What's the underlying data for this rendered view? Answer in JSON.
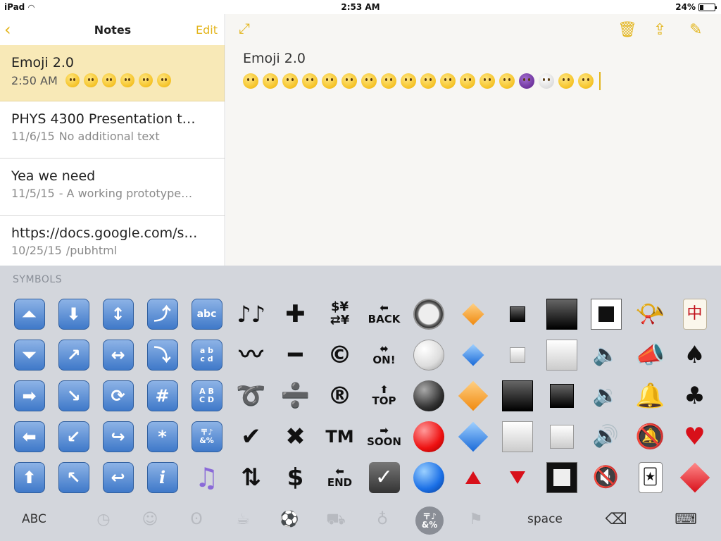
{
  "status_bar": {
    "device": "iPad",
    "time": "2:53 AM",
    "battery": "24%",
    "battery_level": 0.24
  },
  "sidebar": {
    "title": "Notes",
    "edit_label": "Edit",
    "notes": [
      {
        "title": "Emoji 2.0",
        "date": "2:50 AM",
        "preview": "",
        "selected": true
      },
      {
        "title": "PHYS 4300 Presentation t…",
        "date": "11/6/15",
        "preview": "No additional text"
      },
      {
        "title": "Yea we need",
        "date": "11/5/15",
        "preview": "- A working prototype…"
      },
      {
        "title": "https://docs.google.com/s…",
        "date": "10/25/15",
        "preview": "/pubhtml"
      }
    ]
  },
  "editor": {
    "title": "Emoji 2.0"
  },
  "keyboard": {
    "section_label": "SYMBOLS",
    "symbols": [
      [
        "⏫",
        "⬇",
        "↕",
        "⤴",
        "abc",
        "🎶",
        "➕",
        "💱",
        "🔙",
        "🔘",
        "🔸",
        "▪",
        "⬛",
        "🔲",
        "📯",
        "🀄"
      ],
      [
        "⏬",
        "↗",
        "↔",
        "⤵",
        "abcd",
        "〰",
        "➖",
        "©",
        "🔛",
        "⚪",
        "🔹",
        "▫",
        "⬜",
        "🔈",
        "📣",
        "♠"
      ],
      [
        "➡",
        "↘",
        "🔄",
        "#",
        "ABCD",
        "➰",
        "➗",
        "®",
        "🔝",
        "⚫",
        "🔶",
        "◼",
        "◾",
        "🔉",
        "🔔",
        "♣"
      ],
      [
        "⬅",
        "↙",
        "↪",
        "*",
        "🔣",
        "✔",
        "✖",
        "™",
        "🔜",
        "🔴",
        "🔷",
        "◻",
        "◽",
        "🔊",
        "🔕",
        "♥"
      ],
      [
        "⬆",
        "↖",
        "↩",
        "ℹ",
        "🎵",
        "🔃",
        "$",
        "🔚",
        "☑",
        "🔵",
        "🔺",
        "🔻",
        "🔳",
        "🔇",
        "🃏",
        "♦"
      ]
    ],
    "bottom": {
      "abc_label": "ABC",
      "space_label": "space"
    }
  },
  "colors": {
    "accent": "#e3b51c",
    "selected_note": "#f8e9b7",
    "keyboard_bg": "#d3d6dc"
  }
}
